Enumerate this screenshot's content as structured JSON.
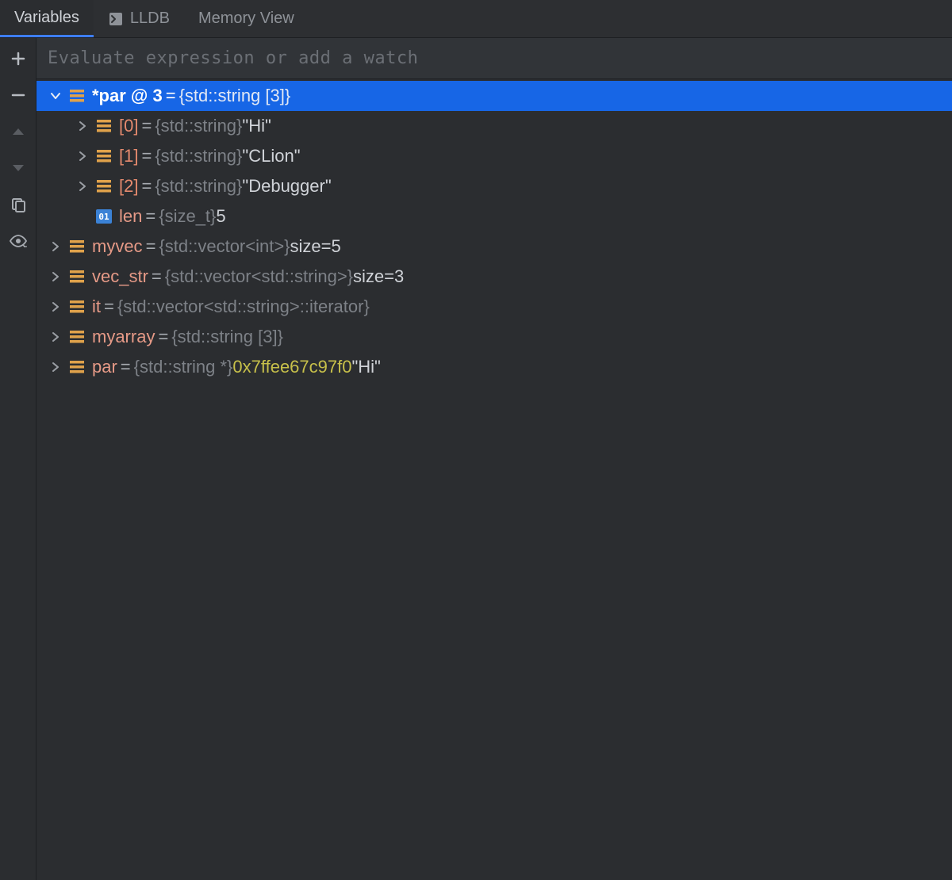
{
  "tabs": {
    "variables": "Variables",
    "lldb": "LLDB",
    "memory": "Memory View"
  },
  "watch": {
    "placeholder": "Evaluate expression or add a watch"
  },
  "rows": {
    "r0": {
      "name": "*par @ 3",
      "eq": " = ",
      "type": "{std::string [3]}"
    },
    "r1": {
      "name": "[0]",
      "eq": " = ",
      "type": "{std::string}",
      "val": " \"Hi\""
    },
    "r2": {
      "name": "[1]",
      "eq": " = ",
      "type": "{std::string}",
      "val": " \"CLion\""
    },
    "r3": {
      "name": "[2]",
      "eq": " = ",
      "type": "{std::string}",
      "val": " \"Debugger\""
    },
    "r4": {
      "name": "len",
      "eq": " = ",
      "type": "{size_t}",
      "val": " 5"
    },
    "r5": {
      "name": "myvec",
      "eq": " = ",
      "type": "{std::vector<int>}",
      "val": " size=5"
    },
    "r6": {
      "name": "vec_str",
      "eq": " = ",
      "type": "{std::vector<std::string>}",
      "val": " size=3"
    },
    "r7": {
      "name": "it",
      "eq": " = ",
      "type": "{std::vector<std::string>::iterator}"
    },
    "r8": {
      "name": "myarray",
      "eq": " = ",
      "type": "{std::string [3]}"
    },
    "r9": {
      "name": "par",
      "eq": " = ",
      "type": "{std::string *}",
      "addr": " 0x7ffee67c97f0",
      "val": " \"Hi\""
    }
  }
}
